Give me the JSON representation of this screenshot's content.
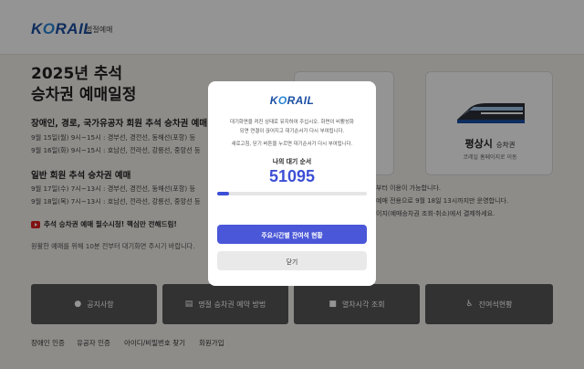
{
  "header": {
    "logo_a": "K",
    "logo_o": "O",
    "logo_b": "RAIL",
    "logo_sub": "명절예매"
  },
  "main": {
    "title_line1": "2025년 추석",
    "title_line2": "승차권 예매일정",
    "section1": {
      "title": "장애인, 경로, 국가유공자 회원 추석 승차권 예매",
      "lines": [
        "9월 15일(월) 9시~15시 : 경부선, 경전선, 동해선(포항) 등",
        "9월 16일(화) 9시~15시 : 호남선, 전라선, 강릉선, 중앙선 등"
      ]
    },
    "section2": {
      "title": "일반 회원 추석 승차권 예매",
      "lines": [
        "9월 17일(수) 7시~13시 : 경부선, 경전선, 동해선(포항) 등",
        "9월 18일(목) 7시~13시 : 호남선, 전라선, 강릉선, 중앙선 등"
      ]
    },
    "promo": "추석 승차권 예매 필수시청! 핵심만 전해드림!",
    "notice": "원활한 예매를 위해 10분 전부터 대기화면 주시기 바랍니다."
  },
  "cards": {
    "regular_title": "평상시",
    "regular_title_suffix": "승차권",
    "regular_sub": "코레일 홈페이지로 이동",
    "info_lines": [
      "부터 이용이 가능합니다.",
      "예매 전용으로 9월 18일 13시까지만 운영합니다.",
      "이지(예매승차권 조회·취소)에서 결제하세요."
    ]
  },
  "buttons": [
    {
      "icon": "●",
      "label": "공지사항"
    },
    {
      "icon": "▤",
      "label": "명절 승차권 예약 방법"
    },
    {
      "icon": "■",
      "label": "열차시각 조회"
    },
    {
      "icon": "♿",
      "label": "잔여석현황"
    }
  ],
  "footer": {
    "links": [
      "장애인 인증",
      "유공자 인증",
      "아이디/비밀번호 찾기",
      "회원가입"
    ]
  },
  "modal": {
    "logo_a": "K",
    "logo_o": "O",
    "logo_b": "RAIL",
    "text1": "대기화면을 켜진 상태로 유지하여 주십시오. 화면이 비활성화",
    "text2": "되면 연결이 끊어지고 대기순서가 다시 부여됩니다.",
    "text3": "새로고침, 닫기 버튼을 누르면 대기순서가 다시 부여됩니다.",
    "queue_label": "나의 대기 순서",
    "queue_number": "51095",
    "progress_fraction": 0.08,
    "primary_button": "주요시간별 잔여석 현황",
    "close_button": "닫기",
    "accent_color": "#3d4fd6"
  }
}
